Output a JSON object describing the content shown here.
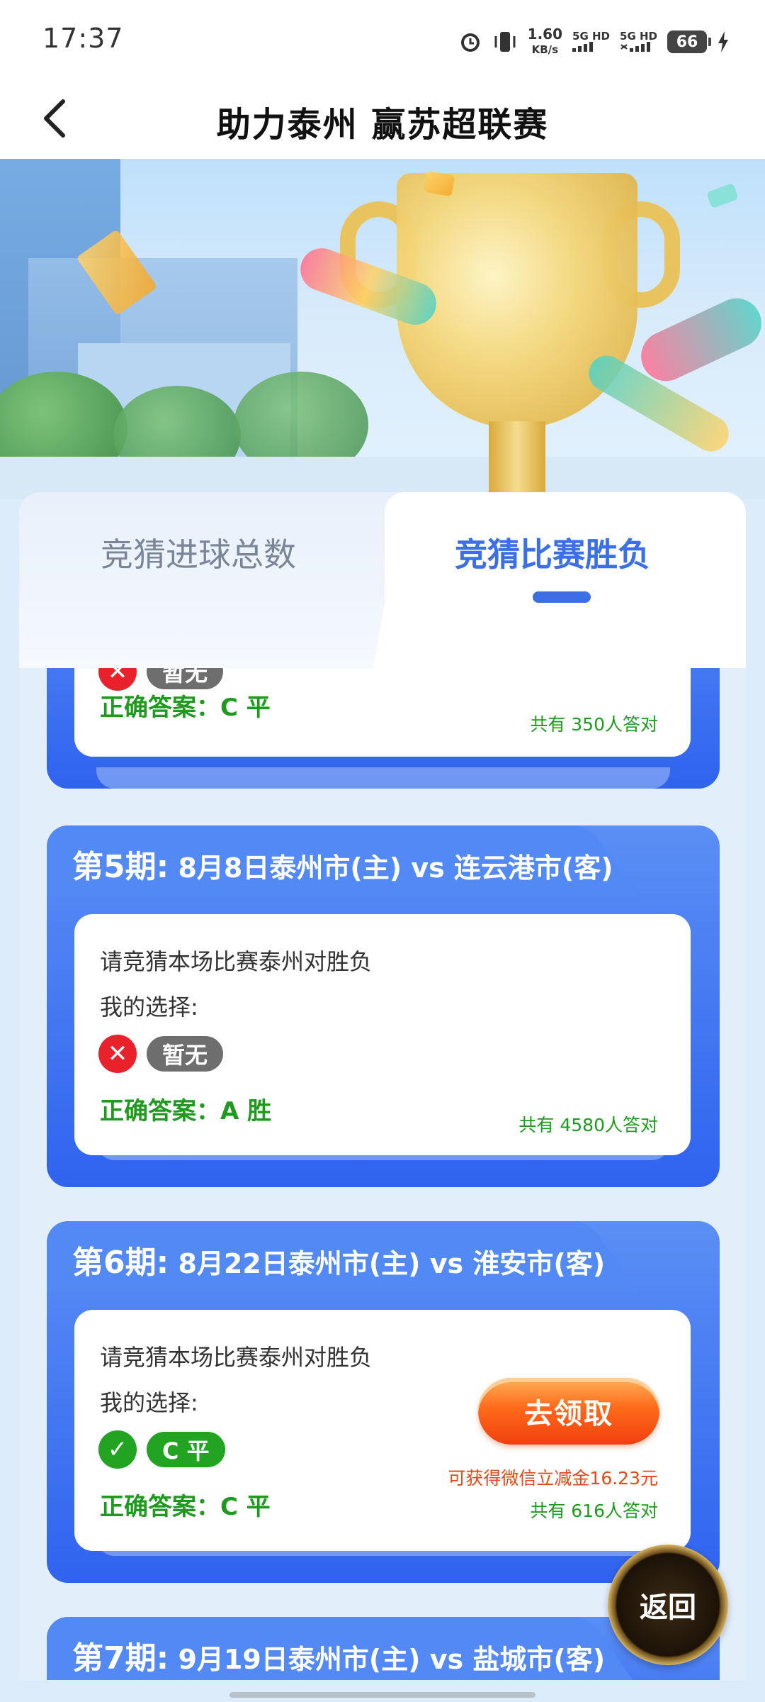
{
  "status_bar": {
    "time": "17:37",
    "speed_value": "1.60",
    "speed_unit": "KB/s",
    "net1": "5G HD",
    "net2": "5G HD",
    "battery": "66"
  },
  "nav": {
    "title": "助力泰州 赢苏超联赛"
  },
  "tabs": [
    {
      "label": "竞猜进球总数",
      "active": false
    },
    {
      "label": "竞猜比赛胜负",
      "active": true
    }
  ],
  "periods": [
    {
      "title_num": "",
      "title_rest": "",
      "question": "",
      "my_choice_label": "",
      "choice": "暂无",
      "choice_correct": false,
      "answer": "正确答案：C 平",
      "count": "共有 350人答对"
    },
    {
      "title_num": "第5期:",
      "title_rest": " 8月8日泰州市(主) vs 连云港市(客)",
      "question": "请竞猜本场比赛泰州对胜负",
      "my_choice_label": "我的选择:",
      "choice": "暂无",
      "choice_correct": false,
      "answer": "正确答案：A 胜",
      "count": "共有 4580人答对"
    },
    {
      "title_num": "第6期:",
      "title_rest": " 8月22日泰州市(主) vs 淮安市(客)",
      "question": "请竞猜本场比赛泰州对胜负",
      "my_choice_label": "我的选择:",
      "choice": "C 平",
      "choice_correct": true,
      "answer": "正确答案：C 平",
      "count": "共有 616人答对",
      "claim_button": "去领取",
      "reward": "可获得微信立减金16.23元"
    },
    {
      "title_num": "第7期:",
      "title_rest": " 9月19日泰州市(主) vs 盐城市(客)"
    }
  ],
  "float_button": "返回",
  "colors": {
    "primary": "#3a6fe6",
    "correct": "#1e9a1e",
    "wrong": "#e8212b",
    "reward": "#e04a1a"
  }
}
